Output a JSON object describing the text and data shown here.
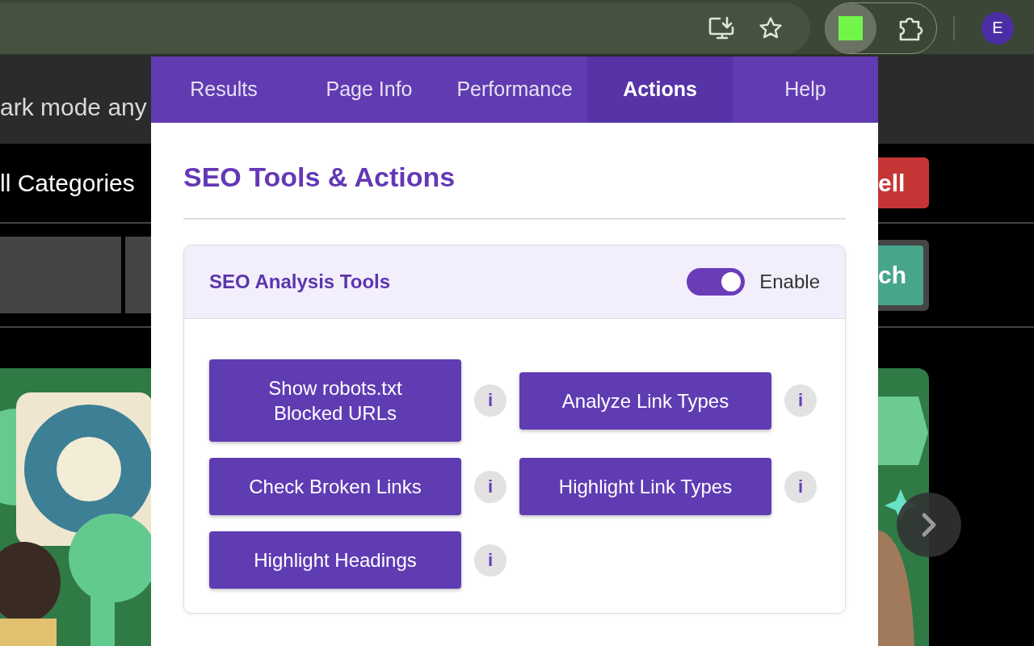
{
  "browser": {
    "profile_initial": "E"
  },
  "page": {
    "notice": "ark mode any",
    "categories": "ll Categories",
    "sell_button": "ell",
    "search_button": "ch"
  },
  "popup": {
    "tabs": [
      {
        "label": "Results",
        "selected": false
      },
      {
        "label": "Page Info",
        "selected": false
      },
      {
        "label": "Performance",
        "selected": false
      },
      {
        "label": "Actions",
        "selected": true
      },
      {
        "label": "Help",
        "selected": false
      }
    ],
    "title": "SEO Tools & Actions",
    "section": {
      "title": "SEO Analysis Tools",
      "enabled": true,
      "toggle_label": "Enable",
      "tools": [
        {
          "label": "Show robots.txt Blocked URLs",
          "info": "i"
        },
        {
          "label": "Analyze Link Types",
          "info": "i"
        },
        {
          "label": "Check Broken Links",
          "info": "i"
        },
        {
          "label": "Highlight Link Types",
          "info": "i"
        },
        {
          "label": "Highlight Headings",
          "info": "i"
        }
      ]
    }
  }
}
